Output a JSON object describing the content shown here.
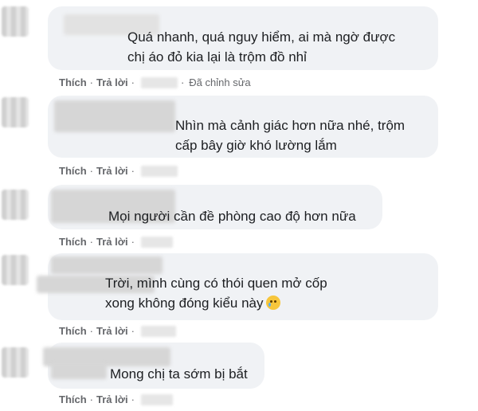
{
  "actions": {
    "like_label": "Thích",
    "reply_label": "Trả lời",
    "separator": "·"
  },
  "comments": [
    {
      "text": "Quá nhanh, quá nguy hiểm, ai mà ngờ được\nchị áo đỏ kia lại là trộm đồ nhỉ",
      "edited": "Đã chỉnh sửa"
    },
    {
      "text": "Nhìn mà cảnh giác hơn nữa nhé, trộm\ncấp bây giờ khó lường lắm"
    },
    {
      "text": "Mọi người cần đề phòng cao độ hơn nữa"
    },
    {
      "text": "Trời, mình cùng có thói quen mở cốp\nxong không đóng kiểu này",
      "emoji": "crying-face"
    },
    {
      "text": "Mong chị ta sớm bị bắt"
    }
  ]
}
